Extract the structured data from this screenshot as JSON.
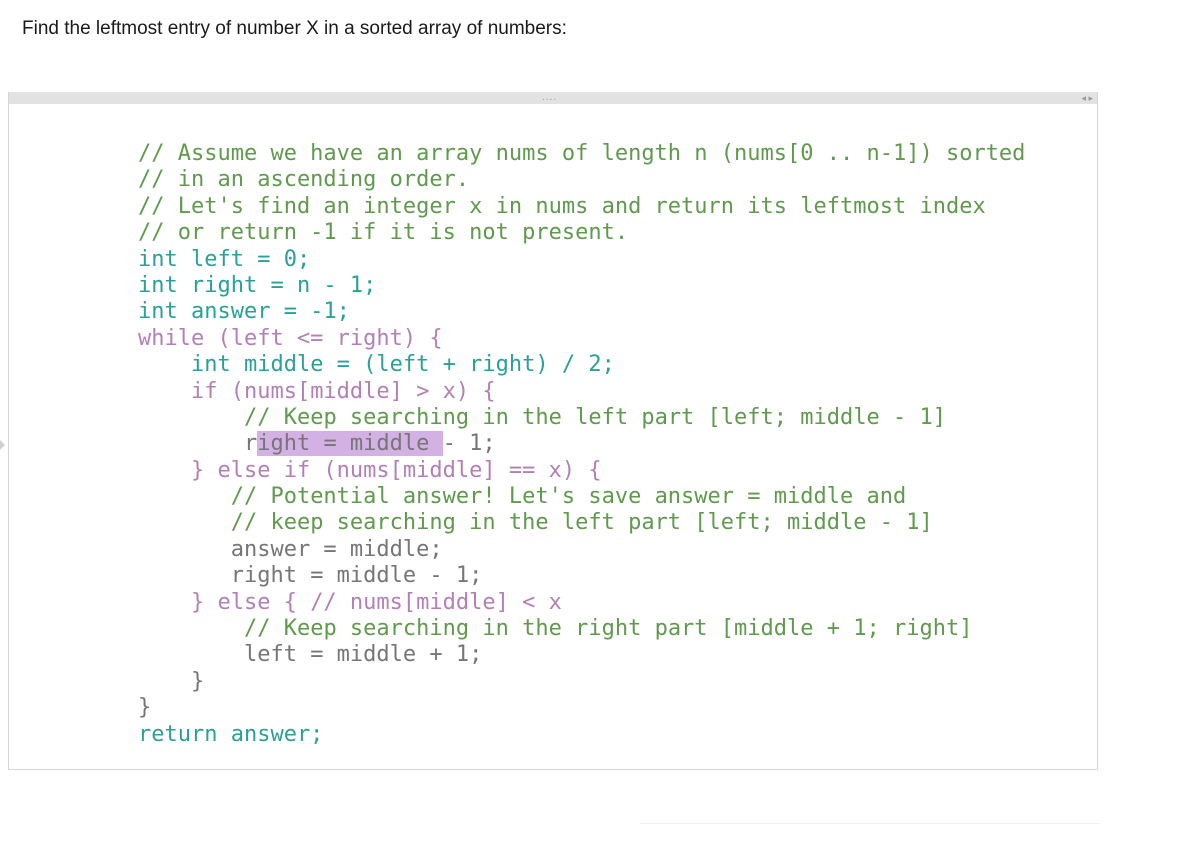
{
  "instruction": "Find the leftmost entry of number X in a sorted array of numbers:",
  "editor": {
    "grip": "....",
    "scroll_arrows": "◂ ▸",
    "lines": [
      {
        "indent": "",
        "text": "// Assume we have an array nums of length n (nums[0 .. n-1]) sorted"
      },
      {
        "indent": "",
        "text": "// in an ascending order."
      },
      {
        "indent": "",
        "text": "// Let's find an integer x in nums and return its leftmost index"
      },
      {
        "indent": "",
        "text": "// or return -1 if it is not present."
      },
      {
        "indent": "",
        "text": "int left = 0;"
      },
      {
        "indent": "",
        "text": "int right = n - 1;"
      },
      {
        "indent": "",
        "text": "int answer = -1;"
      },
      {
        "indent": "",
        "text": "while (left <= right) {"
      },
      {
        "indent": "    ",
        "text": "int middle = (left + right) / 2;"
      },
      {
        "indent": "    ",
        "text": "if (nums[middle] > x) {"
      },
      {
        "indent": "        ",
        "text": "// Keep searching in the left part [left; middle - 1]"
      },
      {
        "indent": "        ",
        "text": "right = middle - 1;"
      },
      {
        "indent": "    ",
        "text": "} else if (nums[middle] == x) {"
      },
      {
        "indent": "       ",
        "text": "// Potential answer! Let's save answer = middle and"
      },
      {
        "indent": "       ",
        "text": "// keep searching in the left part [left; middle - 1]"
      },
      {
        "indent": "       ",
        "text": "answer = middle;"
      },
      {
        "indent": "       ",
        "text": "right = middle - 1;"
      },
      {
        "indent": "    ",
        "text": "} else { // nums[middle] < x"
      },
      {
        "indent": "        ",
        "text": "// Keep searching in the right part [middle + 1; right]"
      },
      {
        "indent": "        ",
        "text": "left = middle + 1;"
      },
      {
        "indent": "    ",
        "text": "}"
      },
      {
        "indent": "",
        "text": "}"
      },
      {
        "indent": "",
        "text": "return answer;"
      }
    ],
    "selection": {
      "line": 11,
      "selected_text": "ight = middle "
    }
  },
  "colors": {
    "comment": "#5f9a4d",
    "keyword": "#b47fb8",
    "type": "#2aa198",
    "variable": "#5b8fb3",
    "selection": "#d4b1e4"
  }
}
